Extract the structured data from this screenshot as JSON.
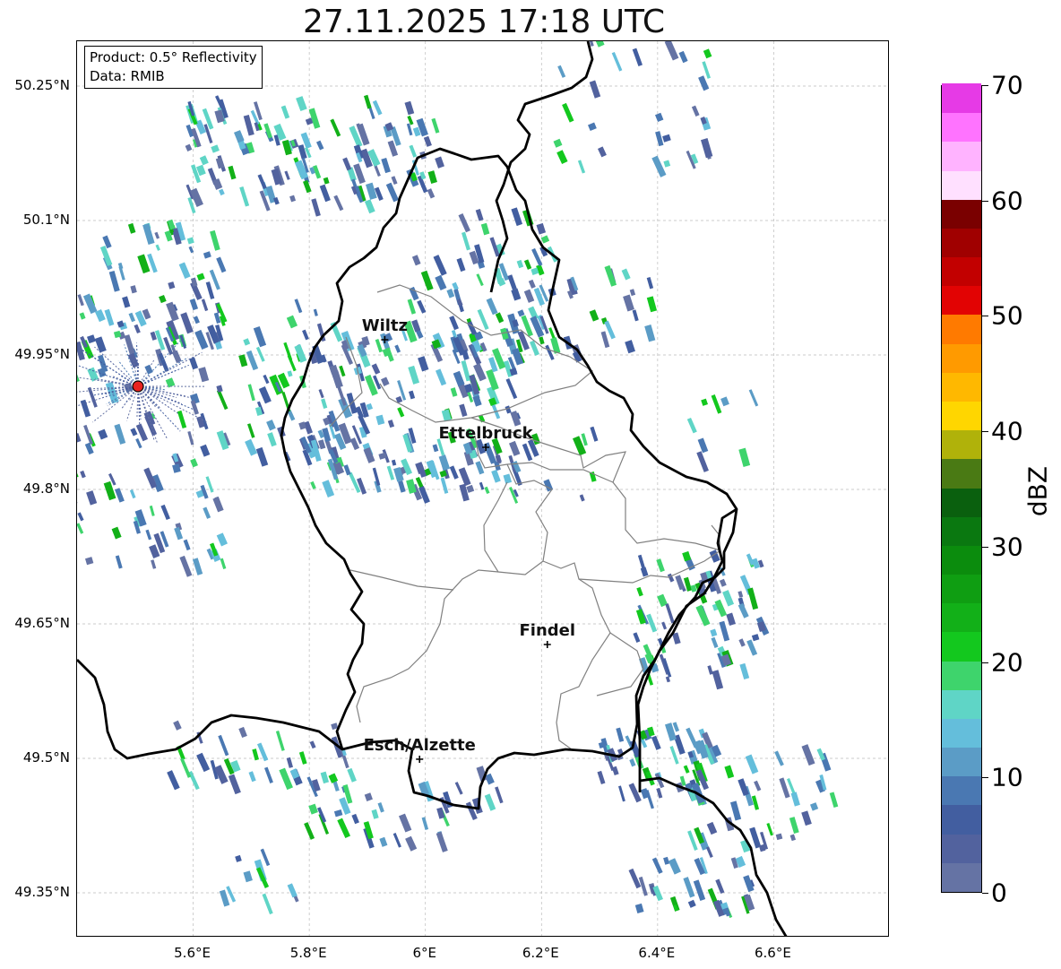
{
  "title": "27.11.2025 17:18 UTC",
  "infobox": {
    "product": "Product: 0.5° Reflectivity",
    "data": "Data: RMIB"
  },
  "map": {
    "lon_range": [
      5.4,
      6.8
    ],
    "lat_range": [
      49.3,
      50.3
    ],
    "lat_ticks": [
      {
        "value": 50.25,
        "label": "50.25°N"
      },
      {
        "value": 50.1,
        "label": "50.1°N"
      },
      {
        "value": 49.95,
        "label": "49.95°N"
      },
      {
        "value": 49.8,
        "label": "49.8°N"
      },
      {
        "value": 49.65,
        "label": "49.65°N"
      },
      {
        "value": 49.5,
        "label": "49.5°N"
      },
      {
        "value": 49.35,
        "label": "49.35°N"
      }
    ],
    "lon_ticks": [
      {
        "value": 5.6,
        "label": "5.6°E"
      },
      {
        "value": 5.8,
        "label": "5.8°E"
      },
      {
        "value": 6.0,
        "label": "6°E"
      },
      {
        "value": 6.2,
        "label": "6.2°E"
      },
      {
        "value": 6.4,
        "label": "6.4°E"
      },
      {
        "value": 6.6,
        "label": "6.6°E"
      }
    ],
    "grid": true,
    "cities": [
      {
        "name": "Wiltz",
        "lon": 5.93,
        "lat": 49.967
      },
      {
        "name": "Ettelbruck",
        "lon": 6.104,
        "lat": 49.847
      },
      {
        "name": "Findel",
        "lon": 6.21,
        "lat": 49.627
      },
      {
        "name": "Esch/Alzette",
        "lon": 5.99,
        "lat": 49.499
      }
    ],
    "radar_site": {
      "lon": 5.505,
      "lat": 49.915,
      "color": "#e8231f"
    },
    "border_color": "#000000",
    "canton_color": "#808080"
  },
  "colorbar": {
    "label": "dBZ",
    "min": 0,
    "max": 70,
    "ticks": [
      {
        "value": 0,
        "label": "0"
      },
      {
        "value": 10,
        "label": "10"
      },
      {
        "value": 20,
        "label": "20"
      },
      {
        "value": 30,
        "label": "30"
      },
      {
        "value": 40,
        "label": "40"
      },
      {
        "value": 50,
        "label": "50"
      },
      {
        "value": 60,
        "label": "60"
      },
      {
        "value": 70,
        "label": "70"
      }
    ],
    "colors": [
      "#6573a4",
      "#52629e",
      "#425ea0",
      "#4a78b2",
      "#5b9cc6",
      "#64bedb",
      "#5fd5c6",
      "#3ed46c",
      "#13c81e",
      "#12b018",
      "#0f9e12",
      "#0b8c0d",
      "#0a7810",
      "#0a600e",
      "#4a7a14",
      "#b0b20a",
      "#ffd600",
      "#ffb800",
      "#ff9a00",
      "#ff7a00",
      "#e20303",
      "#c20000",
      "#a00000",
      "#7a0000",
      "#ffe0ff",
      "#ffb3ff",
      "#ff73ff",
      "#e63ae6"
    ]
  }
}
